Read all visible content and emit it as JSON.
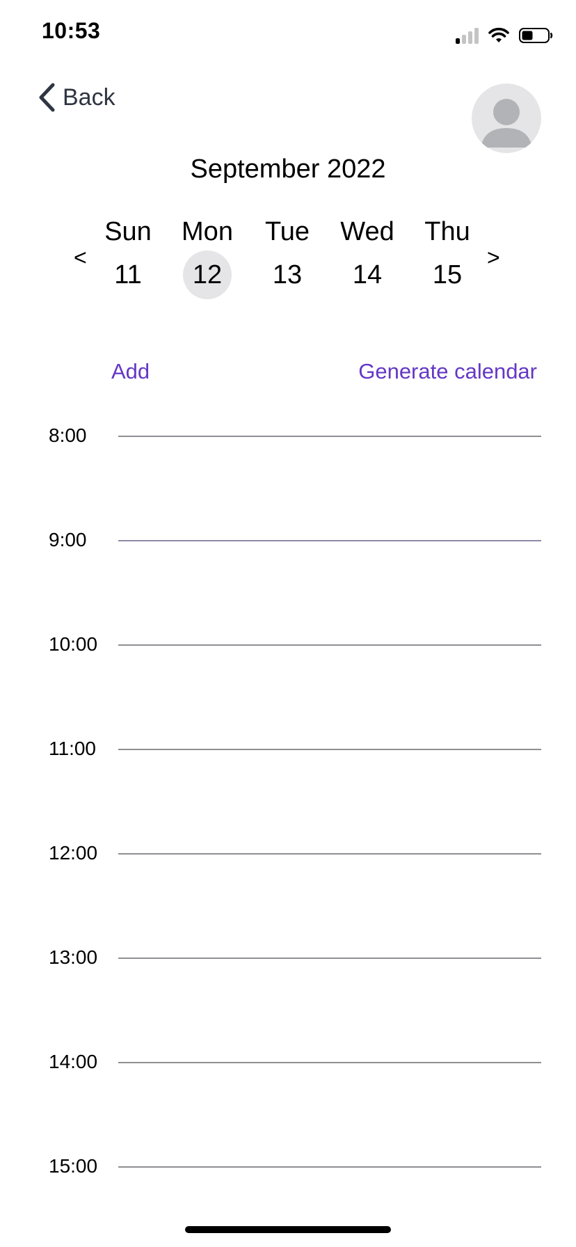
{
  "status_bar": {
    "time": "10:53",
    "icons": [
      "cellular-signal-icon",
      "wifi-icon",
      "battery-icon"
    ]
  },
  "nav": {
    "back_label": "Back",
    "back_icon": "chevron-left-icon",
    "avatar_icon": "user-silhouette-icon"
  },
  "calendar": {
    "month_title": "September 2022",
    "prev_label": "<",
    "next_label": ">",
    "days": [
      {
        "name": "Sun",
        "number": "11",
        "selected": false
      },
      {
        "name": "Mon",
        "number": "12",
        "selected": true
      },
      {
        "name": "Tue",
        "number": "13",
        "selected": false
      },
      {
        "name": "Wed",
        "number": "14",
        "selected": false
      },
      {
        "name": "Thu",
        "number": "15",
        "selected": false
      }
    ]
  },
  "actions": {
    "add_label": "Add",
    "generate_label": "Generate calendar"
  },
  "timeline": {
    "hours": [
      "8:00",
      "9:00",
      "10:00",
      "11:00",
      "12:00",
      "13:00",
      "14:00",
      "15:00"
    ]
  },
  "colors": {
    "accent": "#6438c4",
    "selected_day_bg": "#e5e5e7",
    "grid_line": "#8e8e93"
  }
}
